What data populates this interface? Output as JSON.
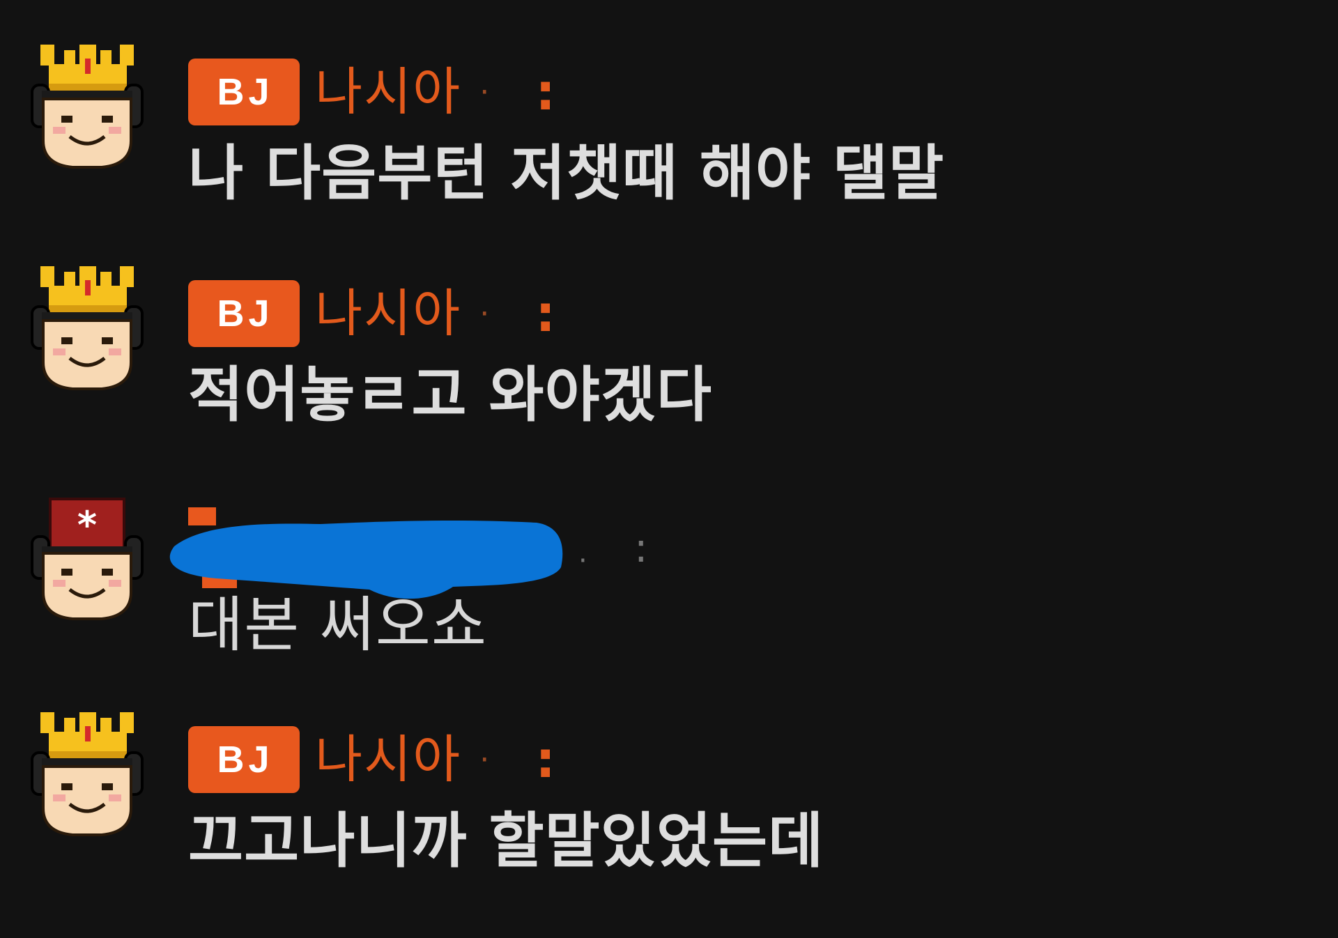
{
  "chat": {
    "messages": [
      {
        "badge": "BJ",
        "nickname": "나시아",
        "separator": "·",
        "colon": ":",
        "text": "나 다음부턴 저챗때 해야 댈말",
        "avatar_icon": "crown-avatar-icon"
      },
      {
        "badge": "BJ",
        "nickname": "나시아",
        "separator": "·",
        "colon": ":",
        "text": "적어놓ㄹ고 와야겠다",
        "avatar_icon": "crown-avatar-icon"
      },
      {
        "badge": "",
        "nickname": "",
        "separator": "·",
        "colon": ":",
        "text": "대본 써오쇼",
        "avatar_icon": "manager-avatar-icon",
        "redacted": true
      },
      {
        "badge": "BJ",
        "nickname": "나시아",
        "separator": "·",
        "colon": ":",
        "text": "끄고나니까 할말있었는데",
        "avatar_icon": "crown-avatar-icon"
      }
    ]
  },
  "colors": {
    "background": "#121212",
    "badge": "#e8581e",
    "nickname": "#e35a1c",
    "message_text": "#dedede",
    "redaction": "#0a74d6"
  }
}
